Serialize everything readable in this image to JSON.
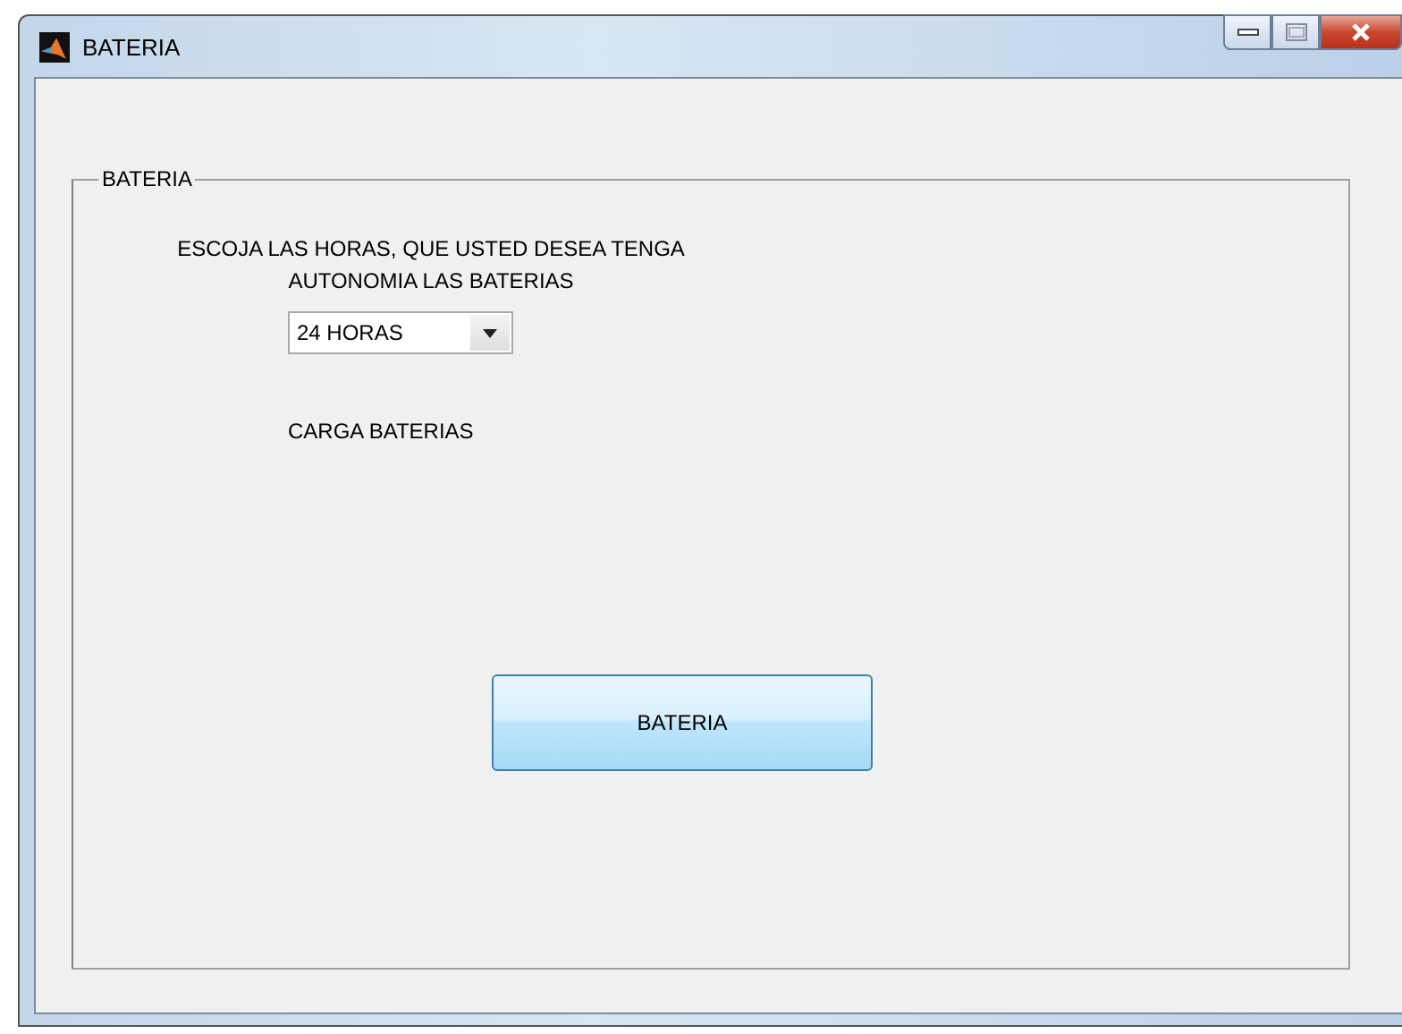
{
  "window": {
    "title": "BATERIA"
  },
  "panel": {
    "title": "BATERIA",
    "instruction": "ESCOJA LAS HORAS, QUE USTED DESEA TENGA\nAUTONOMIA LAS BATERIAS",
    "hours_dropdown": {
      "value": "24 HORAS"
    },
    "status_label": "CARGA BATERIAS",
    "button": "BATERIA"
  }
}
